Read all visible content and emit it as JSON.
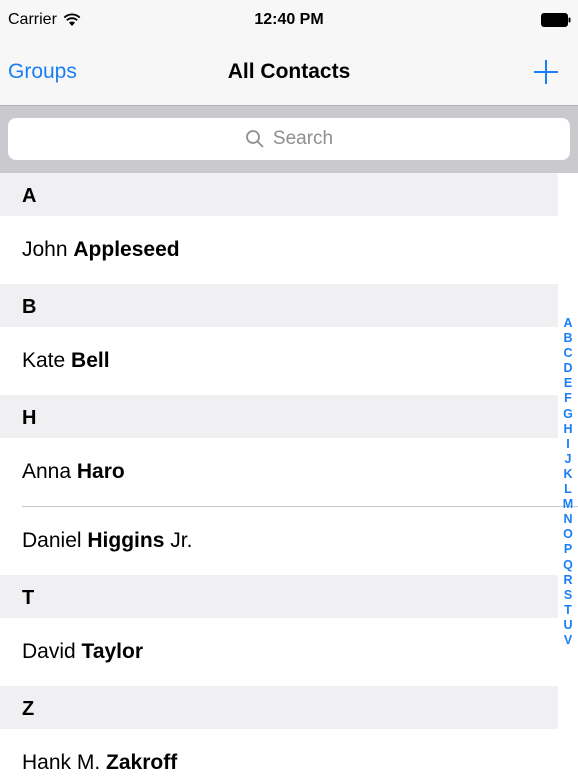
{
  "status_bar": {
    "carrier": "Carrier",
    "time": "12:40 PM",
    "icons": [
      "wifi-icon",
      "battery-icon"
    ]
  },
  "nav_bar": {
    "left_button": "Groups",
    "title": "All Contacts",
    "right_icon": "plus-icon"
  },
  "search": {
    "placeholder": "Search",
    "icon": "search-icon"
  },
  "sections": [
    {
      "letter": "A",
      "contacts": [
        {
          "first": "John",
          "last": "Appleseed",
          "suffix": ""
        }
      ]
    },
    {
      "letter": "B",
      "contacts": [
        {
          "first": "Kate",
          "last": "Bell",
          "suffix": ""
        }
      ]
    },
    {
      "letter": "H",
      "contacts": [
        {
          "first": "Anna",
          "last": "Haro",
          "suffix": ""
        },
        {
          "first": "Daniel",
          "last": "Higgins",
          "suffix": "Jr."
        }
      ]
    },
    {
      "letter": "T",
      "contacts": [
        {
          "first": "David",
          "last": "Taylor",
          "suffix": ""
        }
      ]
    },
    {
      "letter": "Z",
      "contacts": [
        {
          "first": "Hank M.",
          "last": "Zakroff",
          "suffix": ""
        }
      ]
    }
  ],
  "index_letters": [
    "A",
    "B",
    "C",
    "D",
    "E",
    "F",
    "G",
    "H",
    "I",
    "J",
    "K",
    "L",
    "M",
    "N",
    "O",
    "P",
    "Q",
    "R",
    "S",
    "T",
    "U",
    "V"
  ],
  "colors": {
    "accent": "#1a7ff6",
    "bar_background": "#f7f7f7",
    "search_background": "#c9c9ce",
    "section_background": "#f0f0f2"
  }
}
